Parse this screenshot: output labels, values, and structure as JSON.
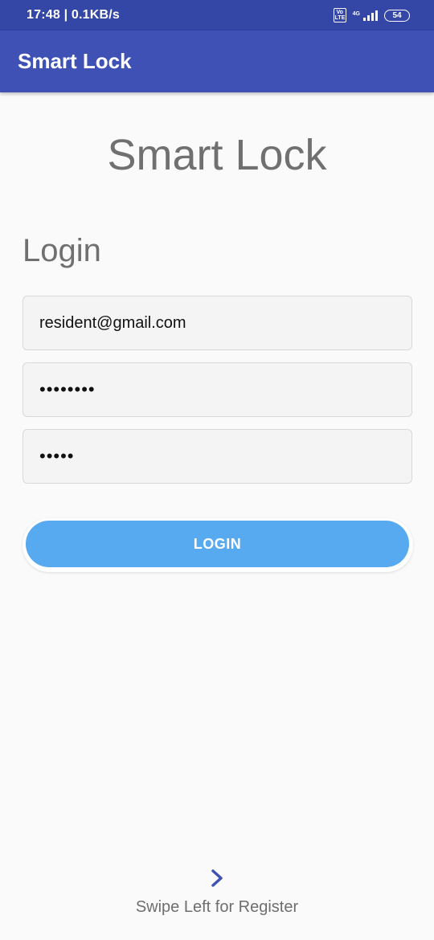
{
  "status_bar": {
    "time_speed": "17:48 | 0.1KB/s",
    "volte_label": "Vo LTE",
    "network": "4G",
    "battery": "54"
  },
  "app_bar": {
    "title": "Smart Lock"
  },
  "main": {
    "brand_title": "Smart Lock",
    "login_heading": "Login",
    "email_value": "resident@gmail.com",
    "password_value": "••••••••",
    "pin_value": "•••••",
    "login_button": "LOGIN"
  },
  "footer": {
    "swipe_hint": "Swipe Left for Register",
    "chevron_icon": "chevron-right-icon",
    "accent_color": "#3f51b5"
  },
  "colors": {
    "status_bar": "#3446a6",
    "app_bar": "#3f51b5",
    "button": "#57a9f0",
    "background": "#fafafa"
  }
}
